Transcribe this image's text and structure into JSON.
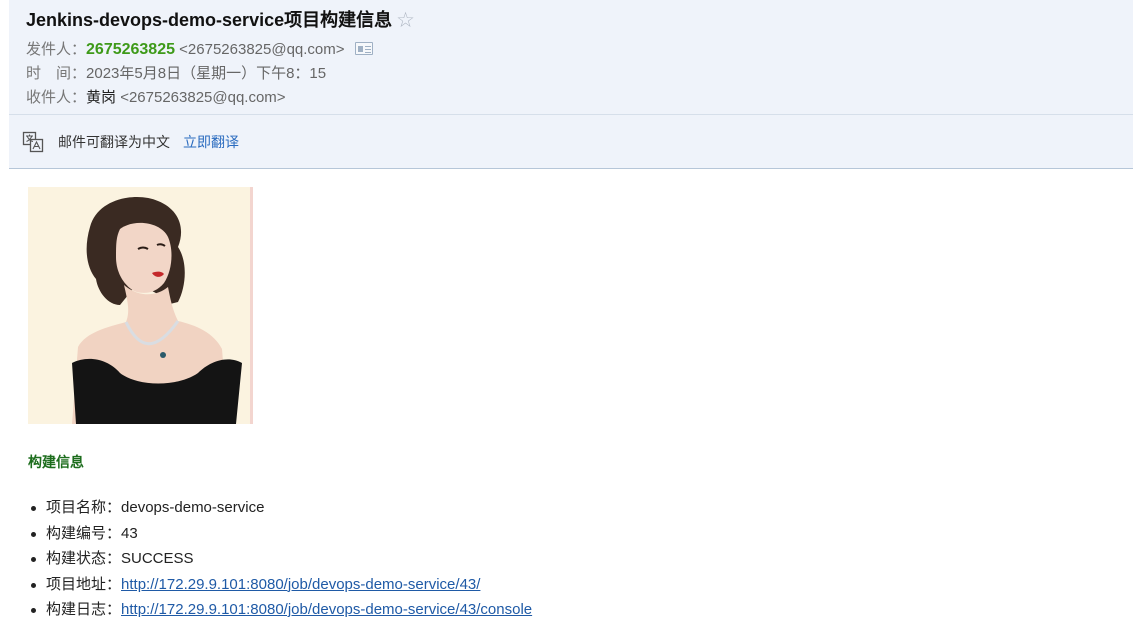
{
  "email": {
    "subject": "Jenkins-devops-demo-service项目构建信息",
    "star_icon": "star-icon",
    "sender_label": "发件人：",
    "sender_name": "2675263825",
    "sender_address": "<2675263825@qq.com>",
    "time_label": "时　间：",
    "time_value": "2023年5月8日（星期一）下午8：15",
    "recipient_label": "收件人：",
    "recipient_name": "黄岗",
    "recipient_address": "<2675263825@qq.com>"
  },
  "translate": {
    "message": "邮件可翻译为中文",
    "action": "立即翻译"
  },
  "body": {
    "section_title": "构建信息",
    "items": [
      {
        "label": "项目名称：",
        "value": "devops-demo-service"
      },
      {
        "label": "构建编号：",
        "value": "43"
      },
      {
        "label": "构建状态：",
        "value": "SUCCESS"
      },
      {
        "label": "项目地址：",
        "value": "http://172.29.9.101:8080/job/devops-demo-service/43/"
      },
      {
        "label": "构建日志：",
        "value": "http://172.29.9.101:8080/job/devops-demo-service/43/console"
      }
    ]
  },
  "colors": {
    "header_bg": "#eff3fa",
    "sender_green": "#3e9a19",
    "section_green": "#1d6d1d",
    "link_blue": "#1f5aa6"
  }
}
